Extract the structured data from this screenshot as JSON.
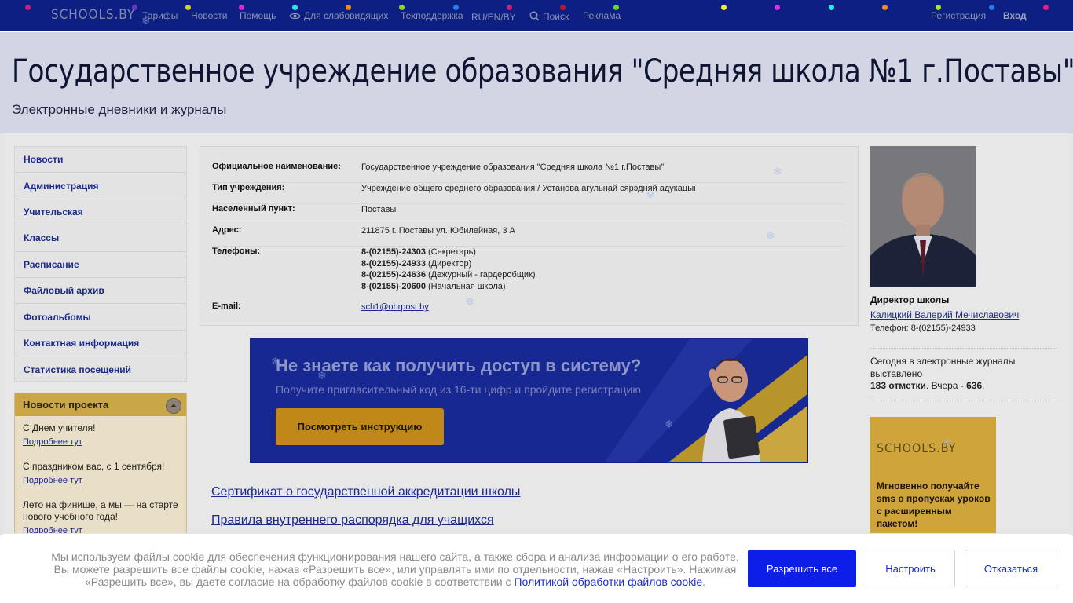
{
  "nav": {
    "logo": "SCHOOLS.BY",
    "items": [
      "Тарифы",
      "Новости",
      "Помощь",
      "Для слабовидящих",
      "Техподдержка",
      "RU/EN/BY",
      "Поиск",
      "Реклама"
    ],
    "register": "Регистрация",
    "login": "Вход"
  },
  "header": {
    "title": "Государственное учреждение образования \"Средняя школа №1 г.Поставы\"",
    "subtitle": "Электронные дневники и журналы"
  },
  "menu": {
    "items": [
      "Новости",
      "Администрация",
      "Учительская",
      "Классы",
      "Расписание",
      "Файловый архив",
      "Фотоальбомы",
      "Контактная информация",
      "Статистика посещений"
    ]
  },
  "project_news": {
    "title": "Новости проекта",
    "items": [
      {
        "title": "С Днем учителя!",
        "link": "Подробнее тут"
      },
      {
        "title": "С праздником вас, с 1 сентября!",
        "link": "Подробнее тут"
      },
      {
        "title": "Лето на финише, а мы — на старте нового учебного года!",
        "link": "Подробнее тут"
      }
    ]
  },
  "info": {
    "official_name_label": "Официальное наименование:",
    "official_name": "Государственное учреждение образования \"Средняя школа №1 г.Поставы\"",
    "type_label": "Тип учреждения:",
    "type": "Учреждение общего среднего образования / Установа агульнай сярэдняй адукацыі",
    "locality_label": "Населенный пункт:",
    "locality": "Поставы",
    "address_label": "Адрес:",
    "address": "211875 г. Поставы ул. Юбилейная, 3 А",
    "phones_label": "Телефоны:",
    "phones": [
      {
        "number": "8-(02155)-24303",
        "note": "(Секретарь)"
      },
      {
        "number": "8-(02155)-24933",
        "note": "(Директор)"
      },
      {
        "number": "8-(02155)-24636",
        "note": "(Дежурный - гардеробщик)"
      },
      {
        "number": "8-(02155)-20600",
        "note": "(Начальная школа)"
      }
    ],
    "email_label": "E-mail:",
    "email": "sch1@obrpost.by"
  },
  "banner": {
    "headline": "Не знаете как получить доступ в систему?",
    "subline": "Получите пригласительный код из 16-ти цифр и пройдите регистрацию",
    "button": "Посмотреть инструкцию"
  },
  "links": [
    "Сертификат о государственной аккредитации школы",
    "Правила внутреннего распорядка для учащихся"
  ],
  "director": {
    "label": "Директор школы",
    "name": "Калицкий Валерий Мечиславович",
    "phone": "Телефон: 8-(02155)-24933"
  },
  "stats": {
    "text": "Сегодня в электронные журналы выставлено",
    "today": "183 отметки",
    "yesterday_label": ". Вчера - ",
    "yesterday": "636",
    "end": "."
  },
  "ad": {
    "logo": "SCHOOLS.BY",
    "text": "Мгновенно получайте sms о пропусках уроков с расширенным пакетом!"
  },
  "cookie": {
    "text": "Мы используем файлы cookie для обеспечения функционирования нашего сайта, а также сбора и анализа информации о его работе. Вы можете разрешить все файлы cookie, нажав «Разрешить все», или управлять ими по отдельности, нажав «Настроить». Нажимая «Разрешить все», вы даете согласие на обработку файлов cookie в соответствии с ",
    "link": "Политикой обработки файлов cookie",
    "end": ".",
    "allow": "Разрешить все",
    "configure": "Настроить",
    "decline": "Отказаться"
  },
  "colors": {
    "nav_bg": "#0d1f82",
    "link": "#1a2a8c",
    "primary_button": "#0c1ee8",
    "news_header": "#c9a648"
  }
}
